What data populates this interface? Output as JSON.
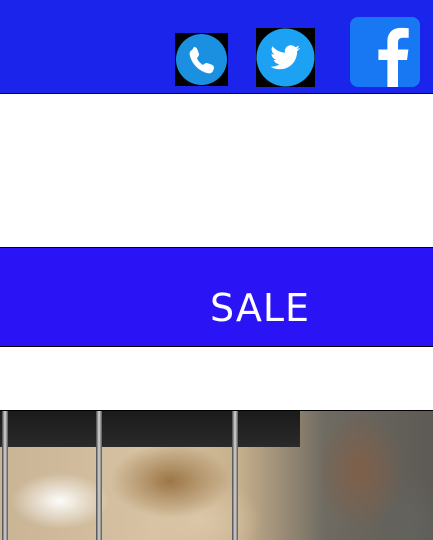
{
  "header": {
    "background_color": "#1a24ea",
    "social": [
      {
        "name": "phone",
        "icon": "phone-icon",
        "color": "#1b8fe0"
      },
      {
        "name": "twitter",
        "icon": "twitter-icon",
        "color": "#1da1f2"
      },
      {
        "name": "facebook",
        "icon": "facebook-icon",
        "color": "#1877f2"
      }
    ]
  },
  "sale_banner": {
    "label": "SALE",
    "background_color": "#2a14f5"
  },
  "product_image": {
    "icon": "product-photo"
  }
}
